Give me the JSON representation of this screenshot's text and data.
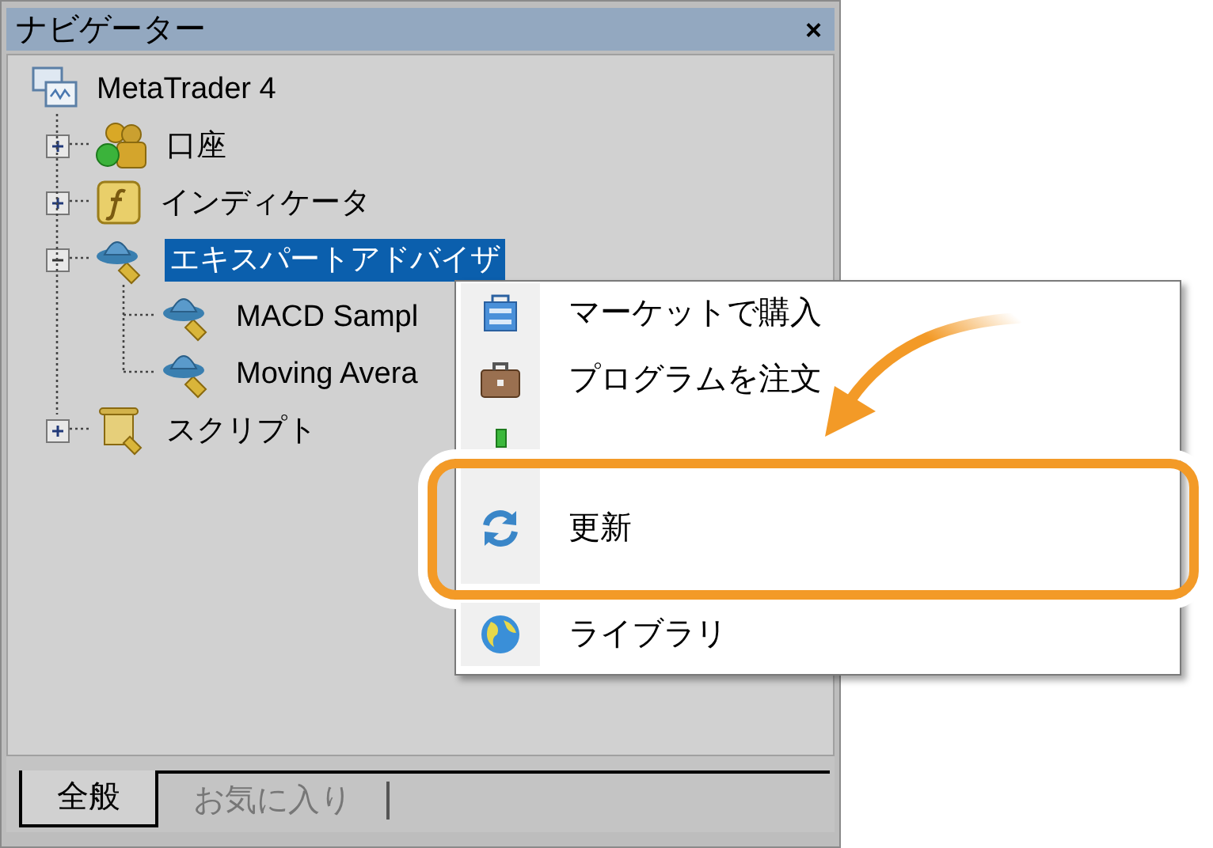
{
  "navigator": {
    "title": "ナビゲーター",
    "close": "×",
    "tree": [
      {
        "label": "MetaTrader 4",
        "kind": "terminal",
        "selected": false,
        "children": [
          {
            "label": "口座",
            "kind": "accounts",
            "expanded": false,
            "selected": false
          },
          {
            "label": "インディケータ",
            "kind": "indicators",
            "expanded": false,
            "selected": false
          },
          {
            "label": "エキスパートアドバイザ",
            "kind": "experts",
            "expanded": true,
            "selected": true,
            "children": [
              {
                "label": "MACD Sampl",
                "kind": "expert",
                "selected": false
              },
              {
                "label": "Moving Avera",
                "kind": "expert",
                "selected": false
              }
            ]
          },
          {
            "label": "スクリプト",
            "kind": "scripts",
            "expanded": false,
            "selected": false
          }
        ]
      }
    ],
    "tabs": [
      {
        "label": "全般",
        "selected": true
      },
      {
        "label": "お気に入り",
        "selected": false
      }
    ]
  },
  "context_menu": {
    "items": [
      {
        "label": "マーケットで購入",
        "kind": "market",
        "annotated": false
      },
      {
        "label": "プログラムを注文",
        "kind": "order",
        "annotated": false
      },
      {
        "kind": "editor",
        "annotated": false
      },
      {
        "label": "更新",
        "kind": "refresh",
        "annotated": true
      },
      {
        "label": "ライブラリ",
        "kind": "library",
        "annotated": false
      }
    ]
  }
}
